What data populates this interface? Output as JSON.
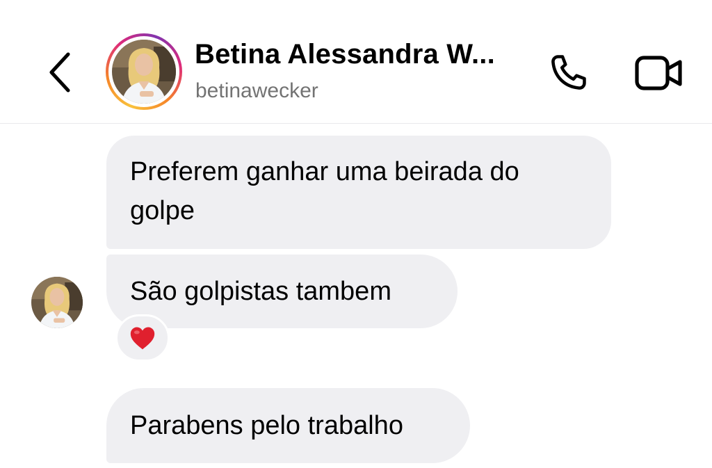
{
  "header": {
    "contact_name": "Betina Alessandra W...",
    "username": "betinawecker",
    "back_icon": "chevron-left-icon",
    "call_icon": "phone-icon",
    "video_icon": "video-camera-icon",
    "story_ring_colors": [
      "#f9c23c",
      "#f58529",
      "#dd2a7b",
      "#8134af"
    ]
  },
  "messages": [
    {
      "text": "Preferem ganhar uma beirada do golpe"
    },
    {
      "text": "São golpistas tambem",
      "reaction_icon": "red-heart-icon",
      "reaction_color": "#e0202e"
    },
    {
      "text": "Parabens pelo trabalho"
    }
  ],
  "colors": {
    "bubble_background": "#efeff2",
    "username_text": "#737373",
    "divider": "#e9e9ec"
  }
}
